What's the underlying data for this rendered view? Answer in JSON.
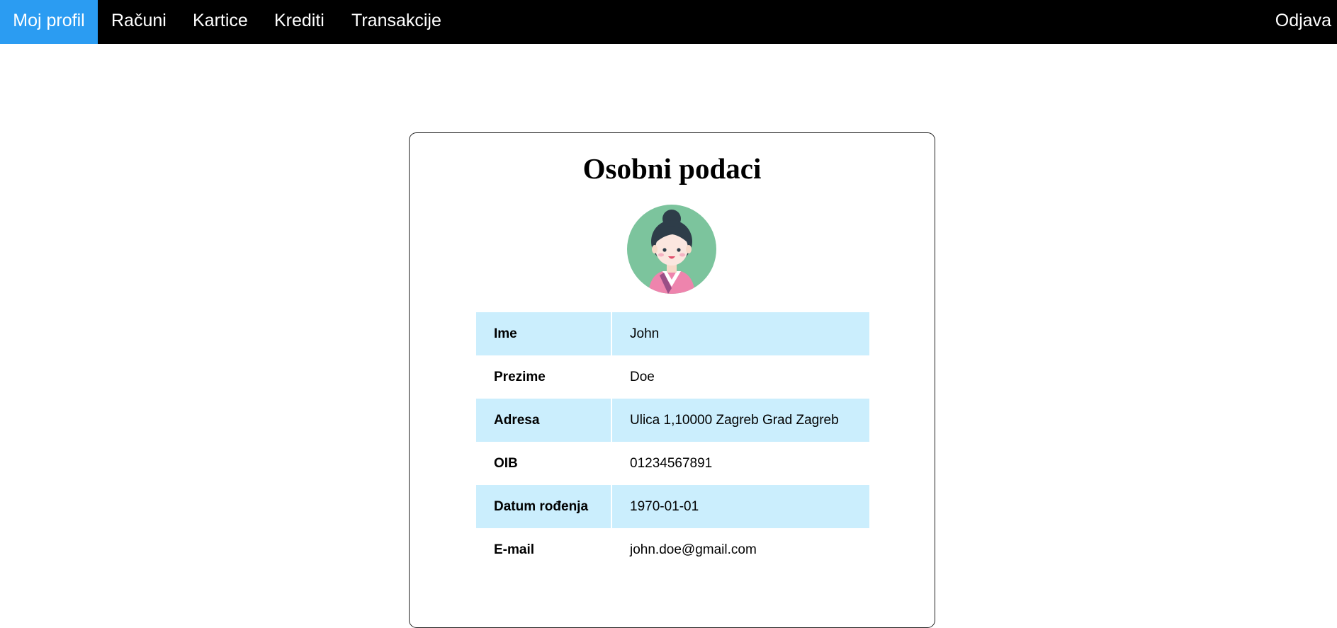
{
  "nav": {
    "items": [
      {
        "label": "Moj profil",
        "active": true
      },
      {
        "label": "Računi",
        "active": false
      },
      {
        "label": "Kartice",
        "active": false
      },
      {
        "label": "Krediti",
        "active": false
      },
      {
        "label": "Transakcije",
        "active": false
      }
    ],
    "logout_label": "Odjava"
  },
  "profile": {
    "title": "Osobni podaci",
    "avatar_icon": "woman-avatar-icon",
    "rows": [
      {
        "label": "Ime",
        "value": "John"
      },
      {
        "label": "Prezime",
        "value": "Doe"
      },
      {
        "label": "Adresa",
        "value": "Ulica 1,10000 Zagreb Grad Zagreb"
      },
      {
        "label": "OIB",
        "value": "01234567891"
      },
      {
        "label": "Datum rođenja",
        "value": "1970-01-01"
      },
      {
        "label": "E-mail",
        "value": "john.doe@gmail.com"
      }
    ]
  },
  "colors": {
    "nav_background": "#000000",
    "nav_active": "#2b9cf2",
    "row_stripe": "#cbeefd",
    "avatar_background": "#7cc49d"
  }
}
